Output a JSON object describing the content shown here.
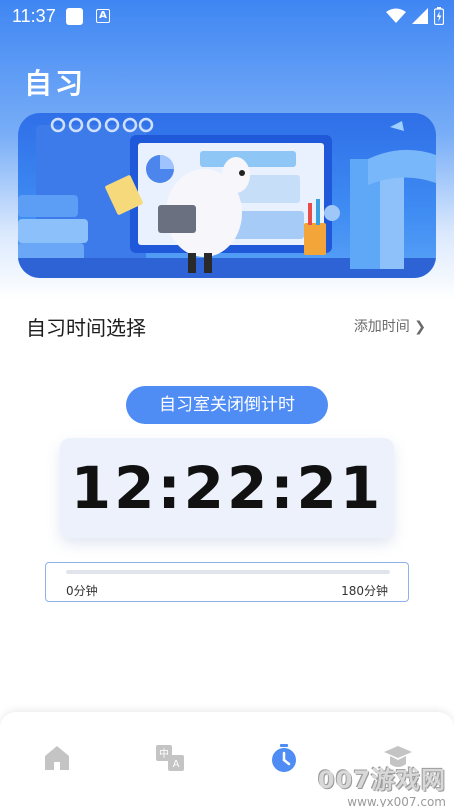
{
  "status_bar": {
    "time": "11:37"
  },
  "header": {
    "title": "自习"
  },
  "section": {
    "title": "自习时间选择",
    "add_time": "添加时间 ❯"
  },
  "countdown": {
    "label": "自习室关闭倒计时",
    "value": "12:22:21"
  },
  "slider": {
    "min_label": "0分钟",
    "max_label": "180分钟",
    "value_fraction": 0
  },
  "bottom_nav": {
    "items": [
      {
        "icon": "home-icon",
        "active": false
      },
      {
        "icon": "translate-icon",
        "active": false
      },
      {
        "icon": "stopwatch-icon",
        "active": true
      },
      {
        "icon": "graduation-cap-icon",
        "active": false
      }
    ]
  },
  "watermark": {
    "main": "007游戏网",
    "sub": "www.yx007.com"
  },
  "colors": {
    "accent": "#4f8df5",
    "inactive_icon": "#c4c4c4"
  }
}
